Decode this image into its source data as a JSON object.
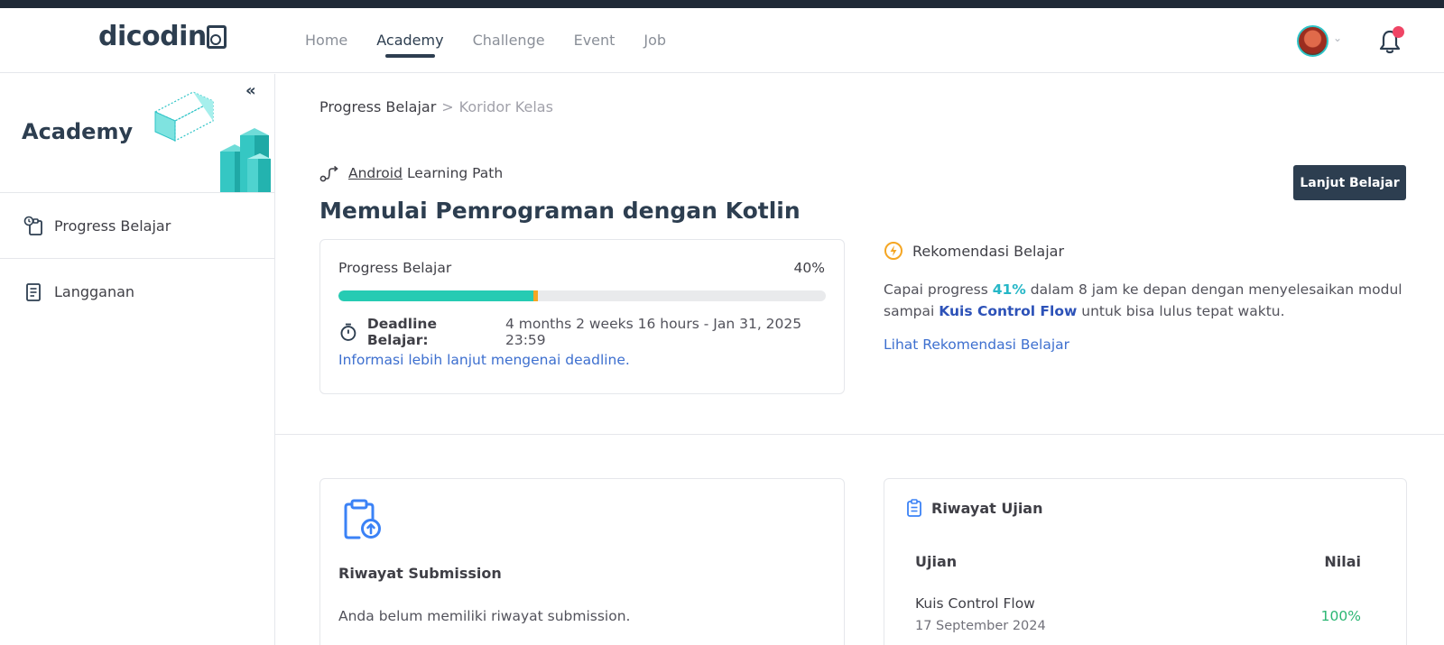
{
  "header": {
    "logo_text": "dicodin",
    "nav": [
      {
        "label": "Home",
        "active": false
      },
      {
        "label": "Academy",
        "active": true
      },
      {
        "label": "Challenge",
        "active": false
      },
      {
        "label": "Event",
        "active": false
      },
      {
        "label": "Job",
        "active": false
      }
    ],
    "avatar_icon": "user-avatar",
    "notification_icon": "bell-icon",
    "notification_dot_color": "#ef4565"
  },
  "sidebar": {
    "title": "Academy",
    "collapse_label": "«",
    "items": [
      {
        "label": "Progress Belajar",
        "icon": "progress-icon"
      },
      {
        "label": "Langganan",
        "icon": "document-icon"
      }
    ]
  },
  "breadcrumb": {
    "parent": "Progress Belajar",
    "separator": ">",
    "current": "Koridor Kelas"
  },
  "course": {
    "path_link": "Android",
    "path_suffix": "Learning Path",
    "title": "Memulai Pemrograman dengan Kotlin",
    "continue_button": "Lanjut Belajar"
  },
  "progress": {
    "label": "Progress Belajar",
    "value_text": "40%",
    "value": 0.4,
    "deadline_label": "Deadline Belajar:",
    "deadline_value": "4 months 2 weeks 16 hours - Jan 31, 2025 23:59",
    "info_link": "Informasi lebih lanjut mengenai deadline.",
    "fill_color": "#26cbb3",
    "marker_color": "#f5a623"
  },
  "recommendation": {
    "title": "Rekomendasi Belajar",
    "text_1": "Capai progress ",
    "target_pct": "41%",
    "text_2": " dalam 8 jam ke depan dengan menyelesaikan modul sampai ",
    "target_module": "Kuis Control Flow",
    "text_3": " untuk bisa lulus tepat waktu.",
    "link": "Lihat Rekomendasi Belajar"
  },
  "submission": {
    "title": "Riwayat Submission",
    "empty_text": "Anda belum memiliki riwayat submission."
  },
  "exam": {
    "title": "Riwayat Ujian",
    "col_exam": "Ujian",
    "col_score": "Nilai",
    "rows": [
      {
        "name": "Kuis Control Flow",
        "date": "17 September 2024",
        "score": "100%"
      }
    ]
  }
}
